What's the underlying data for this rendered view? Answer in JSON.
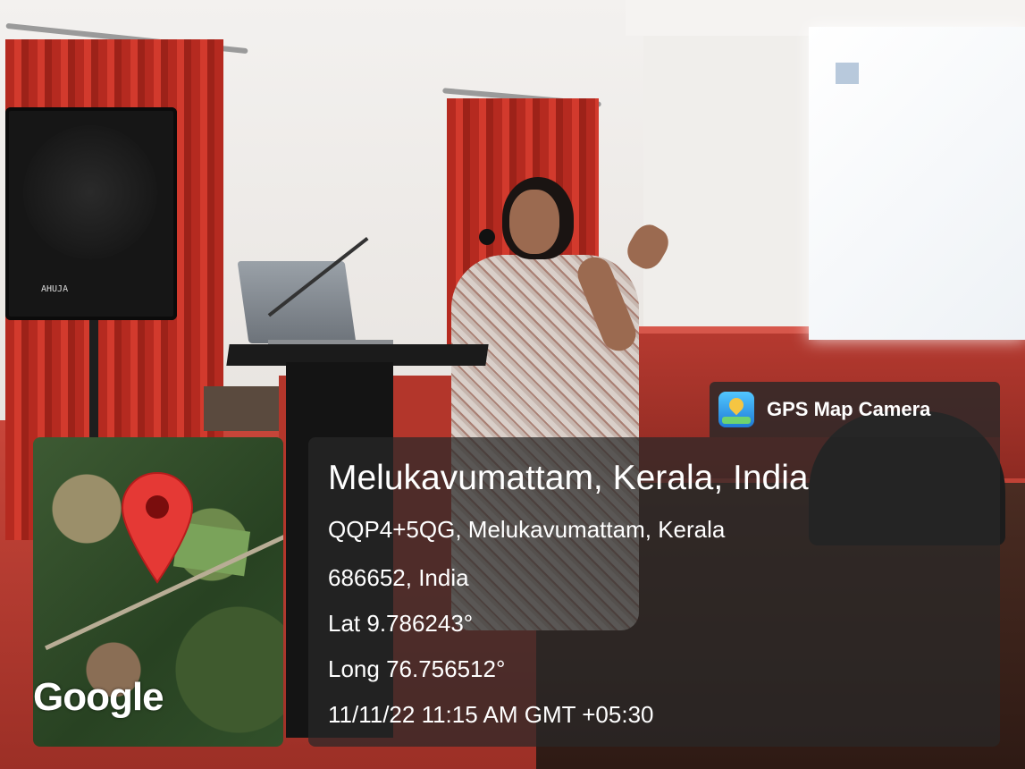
{
  "overlay": {
    "app_label": "GPS Map Camera",
    "app_icon": "gps-map-camera-app-icon",
    "location_title": "Melukavumattam, Kerala, India",
    "address_line1": "QQP4+5QG, Melukavumattam, Kerala",
    "address_line2": "686652, India",
    "latitude": "Lat 9.786243°",
    "longitude": "Long 76.756512°",
    "timestamp": "11/11/22 11:15 AM GMT +05:30"
  },
  "map": {
    "provider_logo": "Google",
    "pin_icon": "map-pin-icon",
    "pin_color": "#e53935"
  },
  "photo": {
    "speaker_brand": "AHUJA"
  }
}
